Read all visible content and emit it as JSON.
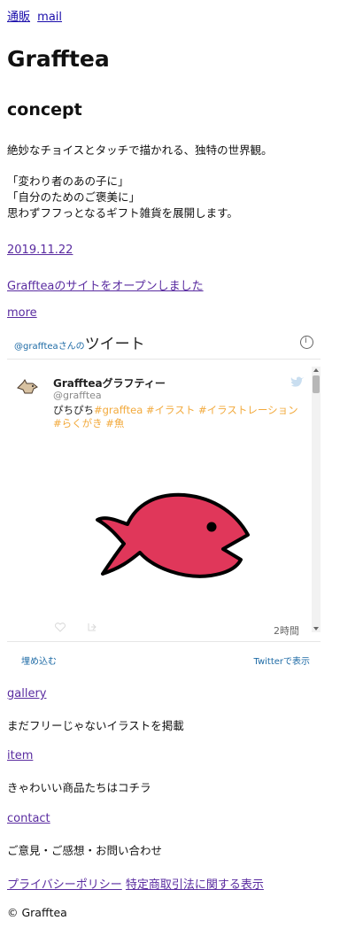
{
  "nav": {
    "links": [
      "通販",
      "mail"
    ]
  },
  "site": {
    "title": "Grafftea"
  },
  "concept": {
    "heading": "concept",
    "lines": [
      "絶妙なチョイスとタッチで描かれる、独特の世界観。",
      "「変わり者のあの子に」",
      "「自分のためのご褒美に」",
      "思わずフフっとなるギフト雑貨を展開します。"
    ]
  },
  "news": {
    "date": "2019.11.22",
    "item": "Graffteaのサイトをオープンしました",
    "more": "more"
  },
  "timeline": {
    "prefix": "@grafftea",
    "prefix_suffix": "さんの",
    "title": "ツイート",
    "tweet": {
      "author": "Graffteaグラフティー",
      "handle": "@grafftea",
      "text_prefix": "ぴちぴち",
      "tags": "#grafftea #イラスト #イラストレーション #らくがき #魚",
      "time": "2時間"
    },
    "footer": {
      "embed": "埋め込む",
      "view": "Twitterで表示"
    }
  },
  "sections": {
    "gallery": {
      "link": "gallery",
      "desc": "まだフリーじゃないイラストを掲載"
    },
    "item": {
      "link": "item",
      "desc": "きゃわいい商品たちはコチラ"
    },
    "contact": {
      "link": "contact",
      "desc": "ご意見・ご感想・お問い合わせ"
    }
  },
  "footer": {
    "privacy": "プライバシーポリシー",
    "commerce": "特定商取引法に関する表示",
    "copyright": "© Grafftea"
  },
  "colors": {
    "link": "#5a2ca0",
    "tag": "#f2a93b",
    "fish": "#e0375a"
  }
}
